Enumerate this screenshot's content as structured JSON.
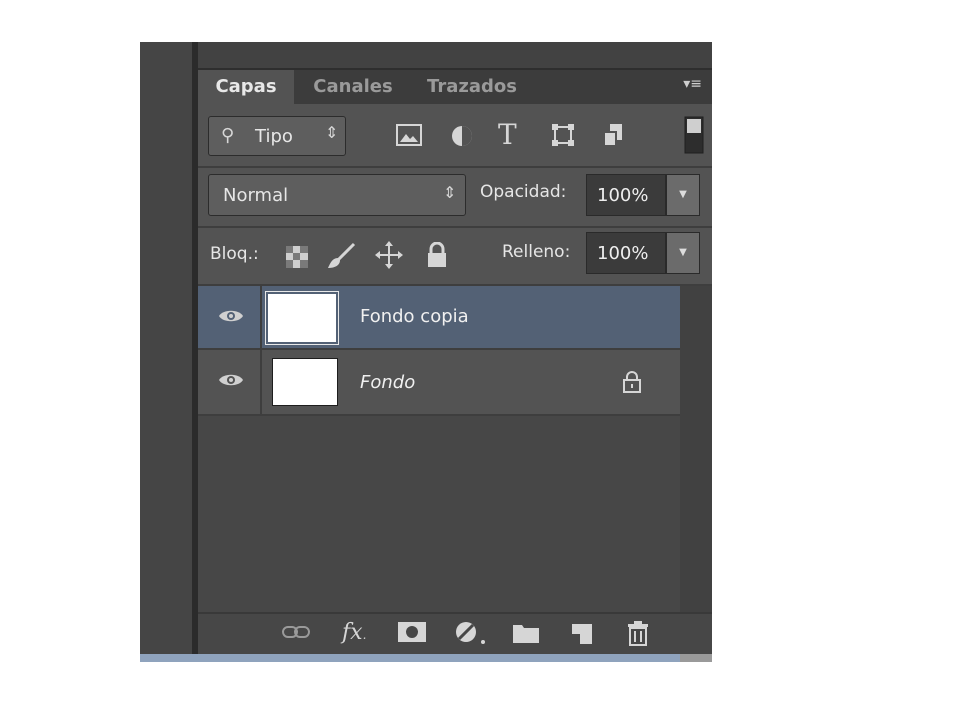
{
  "tabs": [
    "Capas",
    "Canales",
    "Trazados"
  ],
  "filter": {
    "label": "Tipo"
  },
  "blend_mode": "Normal",
  "opacity": {
    "label": "Opacidad:",
    "value": "100%"
  },
  "lock": {
    "label": "Bloq.:"
  },
  "fill": {
    "label": "Relleno:",
    "value": "100%"
  },
  "layers": [
    {
      "name": "Fondo copia",
      "selected": true,
      "locked": false
    },
    {
      "name": "Fondo",
      "selected": false,
      "locked": true
    }
  ],
  "footer": {
    "fx_label": "fx"
  },
  "colors": {
    "selected_row": "#536175",
    "panel_bg": "#535353"
  }
}
